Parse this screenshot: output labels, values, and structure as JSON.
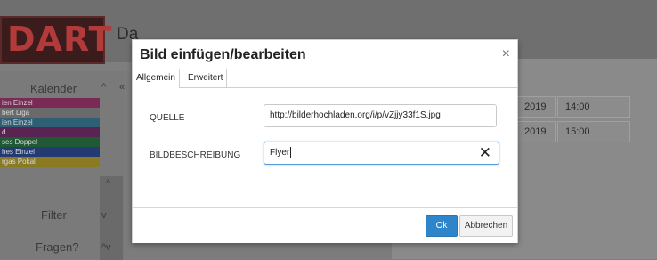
{
  "background": {
    "logo_text": "DART",
    "heading_fragment": "Da",
    "sidebar": {
      "kalender_label": "Kalender",
      "filter_label": "Filter",
      "fragen_label": "Fragen?",
      "legend": [
        {
          "label": "ien Einzel",
          "color": "#7a2a55"
        },
        {
          "label": "bert Liga",
          "color": "#6a6a6a"
        },
        {
          "label": "ien Einzel",
          "color": "#2f5f74"
        },
        {
          "label": "d",
          "color": "#5a2452"
        },
        {
          "label": "ses Doppel",
          "color": "#1f5a34"
        },
        {
          "label": "hes Einzel",
          "color": "#243a72"
        },
        {
          "label": "rgas Pokal",
          "color": "#8a7a22"
        }
      ]
    },
    "table": {
      "rows": [
        {
          "date": "2019",
          "time": "14:00"
        },
        {
          "date": "2019",
          "time": "15:00"
        }
      ]
    }
  },
  "modal": {
    "title": "Bild einfügen/bearbeiten",
    "close_glyph": "×",
    "tabs": [
      {
        "label": "Allgemein",
        "active": true
      },
      {
        "label": "Erweitert",
        "active": false
      }
    ],
    "source": {
      "label": "QUELLE",
      "value": "http://bilderhochladen.org/i/p/vZjjy33f1S.jpg"
    },
    "description": {
      "label": "BILDBESCHREIBUNG",
      "value": "Flyer",
      "clear_glyph": "✕"
    },
    "buttons": {
      "ok": "Ok",
      "cancel": "Abbrechen"
    }
  }
}
